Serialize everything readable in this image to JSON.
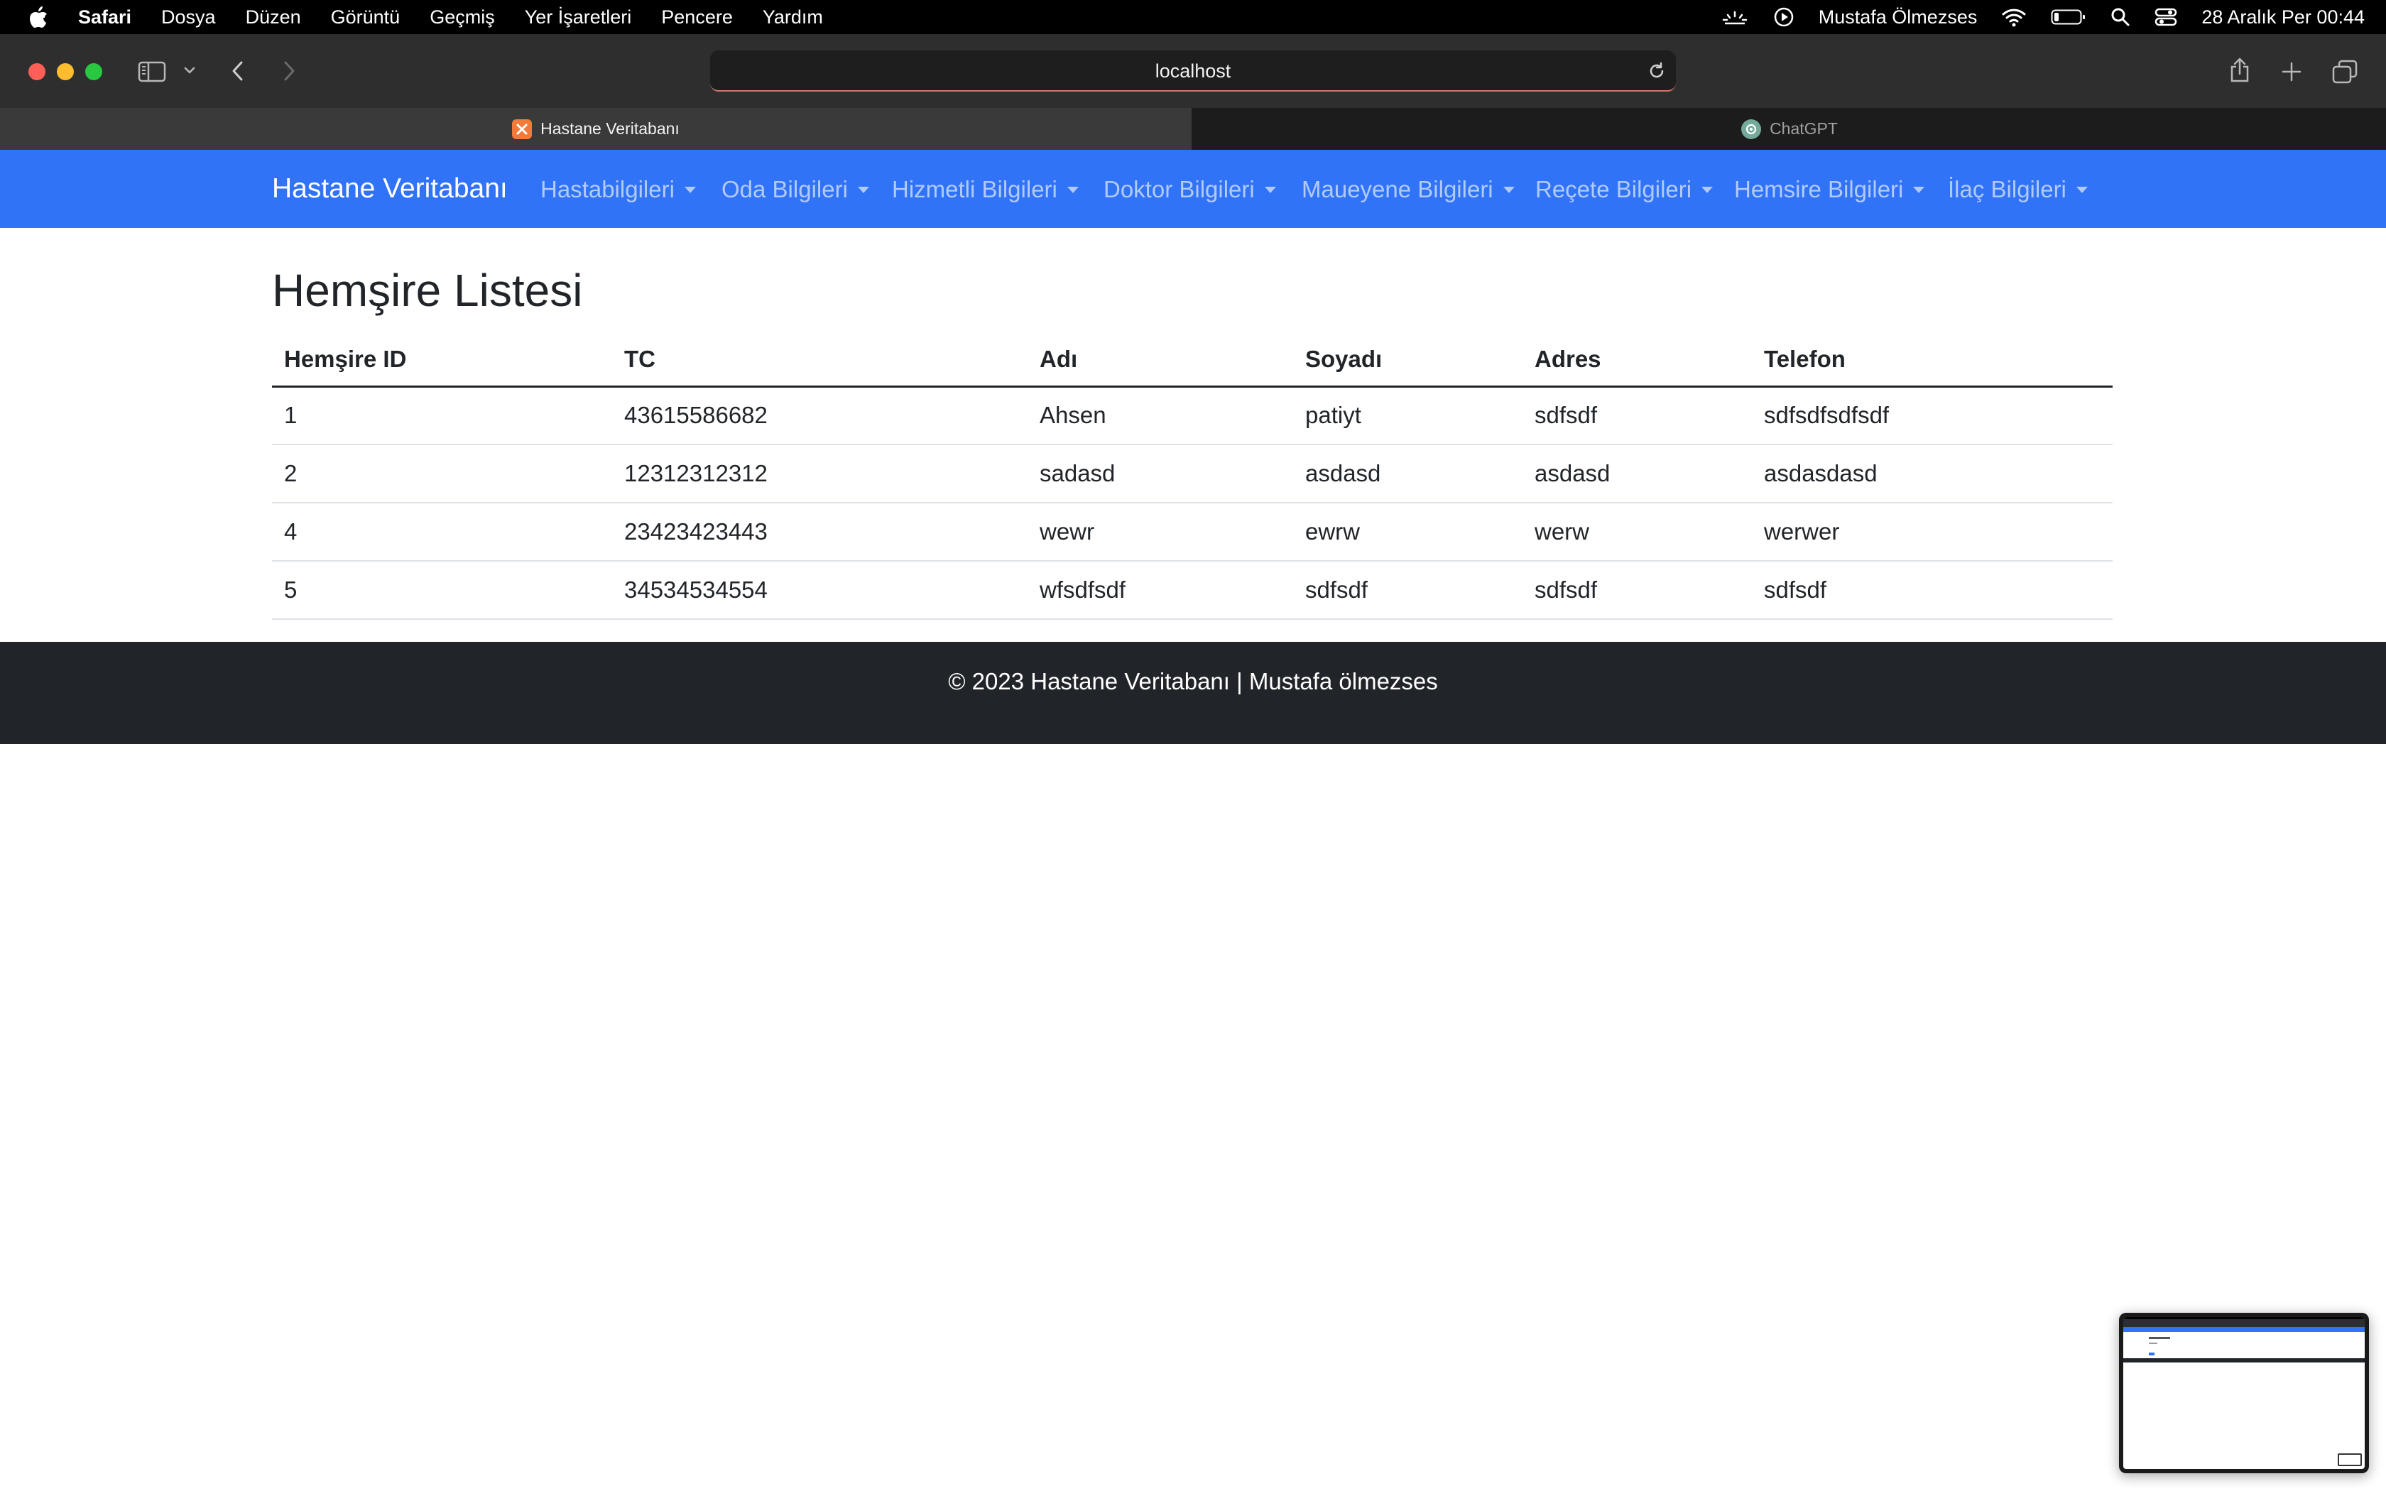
{
  "menubar": {
    "app": "Safari",
    "items": [
      "Dosya",
      "Düzen",
      "Görüntü",
      "Geçmiş",
      "Yer İşaretleri",
      "Pencere",
      "Yardım"
    ],
    "user": "Mustafa Ölmezses",
    "datetime": "28 Aralık Per  00:44"
  },
  "browser": {
    "url": "localhost",
    "tabs": [
      {
        "label": "Hastane Veritabanı",
        "icon": "xampp-icon",
        "active": true
      },
      {
        "label": "ChatGPT",
        "icon": "chatgpt-icon",
        "active": false
      }
    ]
  },
  "navbar": {
    "brand": "Hastane Veritabanı",
    "links": [
      "Hastabilgileri",
      "Oda Bilgileri",
      "Hizmetli Bilgileri",
      "Doktor Bilgileri",
      "Maueyene Bilgileri",
      "Reçete Bilgileri",
      "Hemsire Bilgileri",
      "İlaç Bilgileri"
    ]
  },
  "main": {
    "title": "Hemşire Listesi",
    "columns": [
      "Hemşire ID",
      "TC",
      "Adı",
      "Soyadı",
      "Adres",
      "Telefon"
    ],
    "rows": [
      [
        "1",
        "43615586682",
        "Ahsen",
        "patiyt",
        "sdfsdf",
        "sdfsdfsdfsdf"
      ],
      [
        "2",
        "12312312312",
        "sadasd",
        "asdasd",
        "asdasd",
        "asdasdasd"
      ],
      [
        "4",
        "23423423443",
        "wewr",
        "ewrw",
        "werw",
        "werwer"
      ],
      [
        "5",
        "34534534554",
        "wfsdfsdf",
        "sdfsdf",
        "sdfsdf",
        "sdfsdf"
      ]
    ]
  },
  "footer": {
    "text": "© 2023 Hastane Veritabanı | Mustafa ölmezses"
  },
  "colors": {
    "navbar": "#3173f6",
    "footer": "#212529",
    "close": "#ff5f57",
    "minimize": "#febc2e",
    "zoom": "#28c840"
  }
}
